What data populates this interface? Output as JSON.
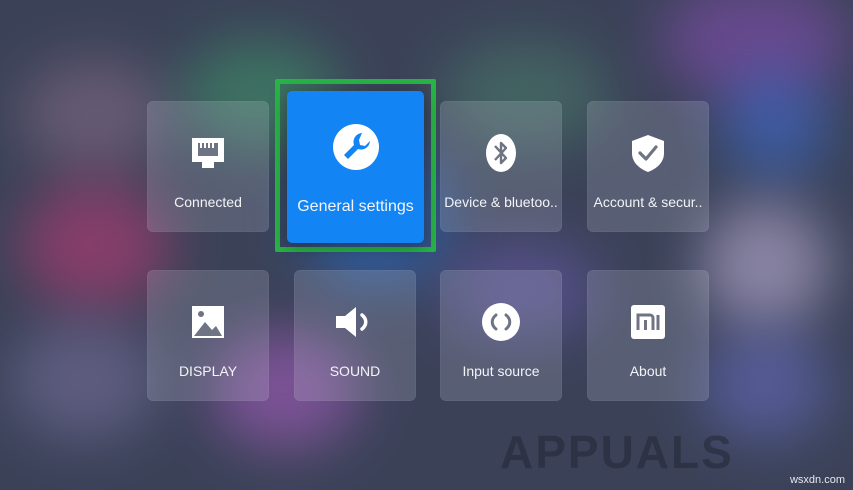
{
  "tiles": {
    "connected": {
      "label": "Connected",
      "icon": "ethernet-icon"
    },
    "general_settings": {
      "label": "General settings",
      "icon": "wrench-icon"
    },
    "device_bluetooth": {
      "label": "Device & bluetoo..",
      "icon": "bluetooth-icon"
    },
    "account_security": {
      "label": "Account & secur..",
      "icon": "shield-check-icon"
    },
    "display": {
      "label": "DISPLAY",
      "icon": "image-icon"
    },
    "sound": {
      "label": "SOUND",
      "icon": "speaker-icon"
    },
    "input_source": {
      "label": "Input source",
      "icon": "input-source-icon"
    },
    "about": {
      "label": "About",
      "icon": "mi-logo-icon"
    }
  },
  "focused_tile": "general_settings",
  "colors": {
    "focus_border": "#28b446",
    "focused_tile_bg": "#1384f4",
    "background": "#3b4258"
  },
  "watermark": {
    "logo_text": "APPUALS",
    "site": "wsxdn.com"
  }
}
